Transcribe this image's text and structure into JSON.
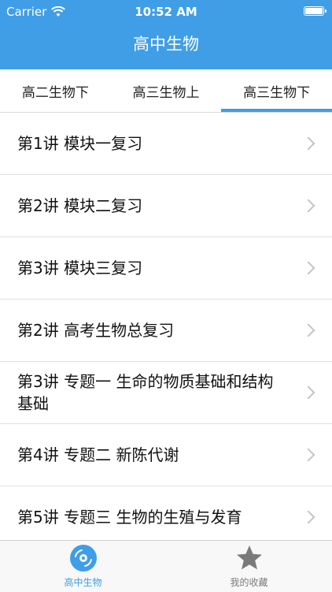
{
  "status": {
    "carrier": "Carrier",
    "time": "10:52 AM"
  },
  "nav": {
    "title": "高中生物"
  },
  "tabs": [
    {
      "label": "高二生物下",
      "active": false
    },
    {
      "label": "高三生物上",
      "active": false
    },
    {
      "label": "高三生物下",
      "active": true
    }
  ],
  "list": [
    {
      "title": "第1讲 模块一复习"
    },
    {
      "title": "第2讲 模块二复习"
    },
    {
      "title": "第3讲 模块三复习"
    },
    {
      "title": "第2讲 高考生物总复习"
    },
    {
      "title": "第3讲 专题一 生命的物质基础和结构基础"
    },
    {
      "title": "第4讲 专题二 新陈代谢"
    },
    {
      "title": "第5讲 专题三 生物的生殖与发育"
    }
  ],
  "tabbar": [
    {
      "label": "高中生物",
      "icon": "disc-icon",
      "active": true
    },
    {
      "label": "我的收藏",
      "icon": "star-icon",
      "active": false
    }
  ],
  "colors": {
    "accent": "#3f9ee6",
    "inactive": "#7a7a7a"
  }
}
